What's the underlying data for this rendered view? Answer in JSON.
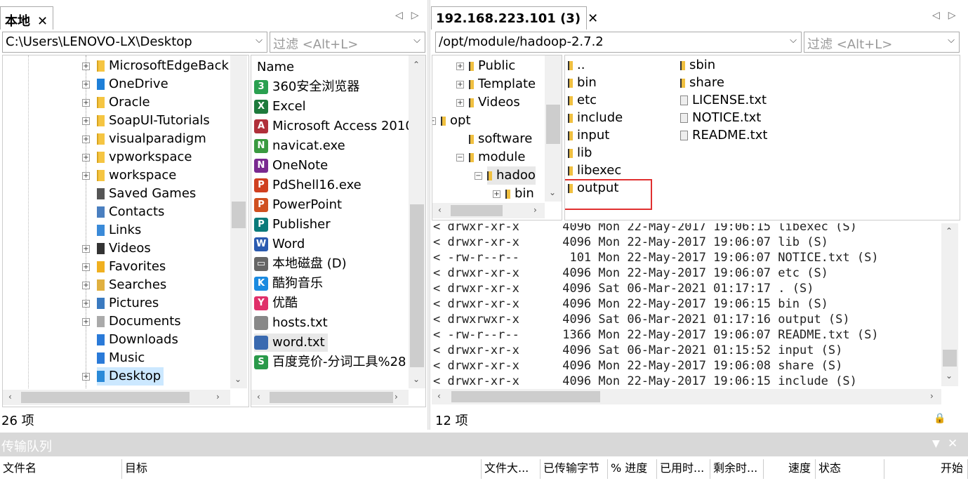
{
  "left": {
    "tab_title": "本地",
    "path": "C:\\Users\\LENOVO-LX\\Desktop",
    "filter_placeholder": "过滤 <Alt+L>",
    "tree": [
      "MicrosoftEdgeBack",
      "OneDrive",
      "Oracle",
      "SoapUI-Tutorials",
      "visualparadigm",
      "vpworkspace",
      "workspace",
      "Saved Games",
      "Contacts",
      "Links",
      "Videos",
      "Favorites",
      "Searches",
      "Pictures",
      "Documents",
      "Downloads",
      "Music",
      "Desktop"
    ],
    "list_header": "Name",
    "files": [
      "360安全浏览器",
      "Excel",
      "Microsoft Access 2010",
      "navicat.exe",
      "OneNote",
      "PdShell16.exe",
      "PowerPoint",
      "Publisher",
      "Word",
      "本地磁盘 (D)",
      "酷狗音乐",
      "优酷",
      "hosts.txt",
      "word.txt",
      "百度竞价-分词工具%28"
    ],
    "status": "26 项"
  },
  "right": {
    "tab_title": "192.168.223.101 (3)",
    "path": "/opt/module/hadoop-2.7.2",
    "filter_placeholder": "过滤 <Alt+L>",
    "tree": [
      "Public",
      "Template",
      "Videos",
      "opt",
      "software",
      "module",
      "hadoo",
      "bin"
    ],
    "files_col1": [
      "..",
      "bin",
      "etc",
      "include",
      "input",
      "lib",
      "libexec",
      "output"
    ],
    "files_col2": [
      "sbin",
      "share",
      "LICENSE.txt",
      "NOTICE.txt",
      "README.txt"
    ],
    "highlighted": "output",
    "log": [
      "< drwxr-xr-x      4096 Mon 22-May-2017 19:06:15 libexec (S)",
      "< drwxr-xr-x      4096 Mon 22-May-2017 19:06:07 lib (S)",
      "< -rw-r--r--       101 Mon 22-May-2017 19:06:07 NOTICE.txt (S)",
      "< drwxr-xr-x      4096 Mon 22-May-2017 19:06:07 etc (S)",
      "< drwxr-xr-x      4096 Sat 06-Mar-2021 01:17:17 . (S)",
      "< drwxr-xr-x      4096 Mon 22-May-2017 19:06:15 bin (S)",
      "< drwxrwxr-x      4096 Sat 06-Mar-2021 01:17:16 output (S)",
      "< -rw-r--r--      1366 Mon 22-May-2017 19:06:07 README.txt (S)",
      "< drwxr-xr-x      4096 Sat 06-Mar-2021 01:15:52 input (S)",
      "< drwxr-xr-x      4096 Mon 22-May-2017 19:06:08 share (S)",
      "< drwxr-xr-x      4096 Mon 22-May-2017 19:06:15 include (S)"
    ],
    "status": "12 项"
  },
  "queue": {
    "title": "传输队列",
    "columns": [
      "文件名",
      "目标",
      "文件大...",
      "已传输字节",
      "% 进度",
      "已用时...",
      "剩余时...",
      "速度",
      "状态",
      "开始"
    ]
  },
  "icons": {
    "close": "close-icon",
    "prev": "arrow-left-icon",
    "next": "arrow-right-icon",
    "lock": "lock-icon"
  },
  "colors": {
    "highlight_box": "#e03030",
    "selected_bg": "#cce8ff",
    "queue_bar": "#d8d8d8"
  }
}
